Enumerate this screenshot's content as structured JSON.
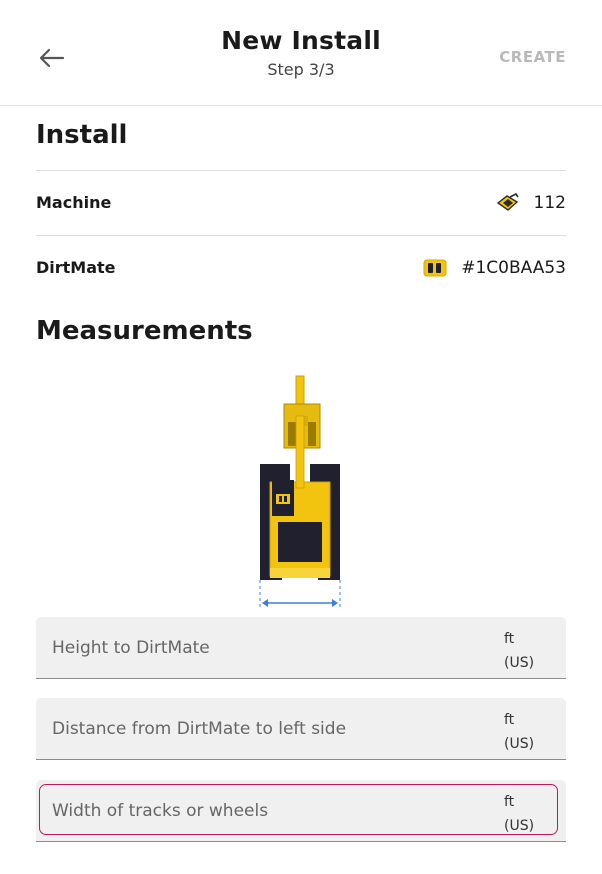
{
  "header": {
    "title": "New Install",
    "subtitle": "Step 3/3",
    "create_label": "CREATE"
  },
  "install": {
    "section_title": "Install",
    "machine": {
      "label": "Machine",
      "value": "112",
      "icon": "excavator-icon"
    },
    "dirtmate": {
      "label": "DirtMate",
      "value": "#1C0BAA53",
      "icon": "dirtmate-icon"
    }
  },
  "measurements": {
    "section_title": "Measurements",
    "diagram_icon": "excavator-top-view",
    "fields": [
      {
        "placeholder": "Height to DirtMate",
        "unit_line1": "ft",
        "unit_line2": "(US)",
        "value": ""
      },
      {
        "placeholder": "Distance from DirtMate to left side",
        "unit_line1": "ft",
        "unit_line2": "(US)",
        "value": ""
      },
      {
        "placeholder": "Width of tracks or wheels",
        "unit_line1": "ft",
        "unit_line2": "(US)",
        "value": "",
        "focused": true
      }
    ]
  },
  "colors": {
    "accent_focus": "#c2185b",
    "machine_yellow": "#f2c40f",
    "track_dark": "#20202e",
    "measure_blue": "#3d7fe0",
    "disabled_text": "#b9b9b9"
  }
}
